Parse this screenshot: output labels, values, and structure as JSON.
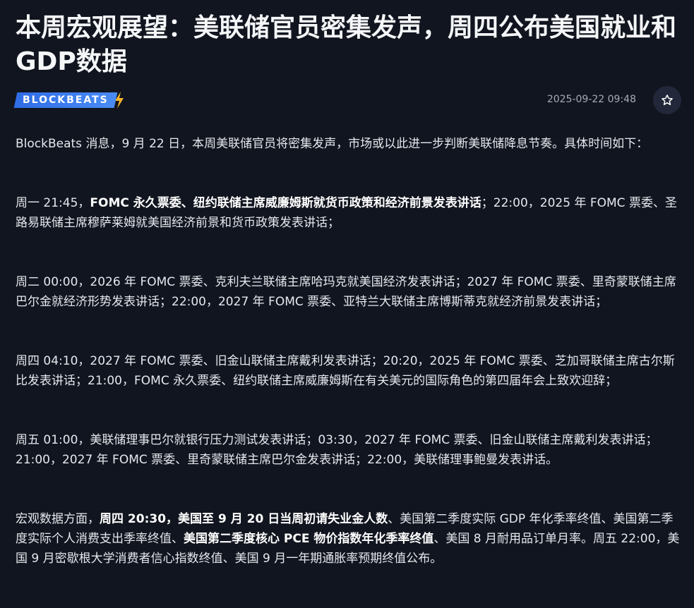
{
  "article": {
    "title": "本周宏观展望：美联储官员密集发声，周四公布美国就业和GDP数据",
    "source_logo": "BLOCKBEATS",
    "datetime": "2025-09-22 09:48",
    "favorite_icon": "star-outline-icon"
  },
  "paragraphs": [
    [
      {
        "t": "BlockBeats 消息，9 月 22 日，本周美联储官员将密集发声，市场或以此进一步判断美联储降息节奏。具体时间如下：",
        "b": false
      }
    ],
    [
      {
        "t": "周一 21:45，",
        "b": false
      },
      {
        "t": "FOMC 永久票委、纽约联储主席威廉姆斯就货币政策和经济前景发表讲话",
        "b": true
      },
      {
        "t": "；22:00，2025 年 FOMC 票委、圣路易联储主席穆萨莱姆就美国经济前景和货币政策发表讲话；",
        "b": false
      }
    ],
    [
      {
        "t": "周二 00:00，2026 年 FOMC 票委、克利夫兰联储主席哈玛克就美国经济发表讲话；2027 年 FOMC 票委、里奇蒙联储主席巴尔金就经济形势发表讲话；22:00，2027 年 FOMC 票委、亚特兰大联储主席博斯蒂克就经济前景发表讲话；",
        "b": false
      }
    ],
    [
      {
        "t": "周四 04:10，2027 年 FOMC 票委、旧金山联储主席戴利发表讲话；20:20，2025 年 FOMC 票委、芝加哥联储主席古尔斯比发表讲话；21:00，FOMC 永久票委、纽约联储主席威廉姆斯在有关美元的国际角色的第四届年会上致欢迎辞；",
        "b": false
      }
    ],
    [
      {
        "t": "周五 01:00，美联储理事巴尔就银行压力测试发表讲话；03:30，2027 年 FOMC 票委、旧金山联储主席戴利发表讲话；21:00，2027 年 FOMC 票委、里奇蒙联储主席巴尔金发表讲话；22:00，美联储理事鲍曼发表讲话。",
        "b": false
      }
    ],
    [
      {
        "t": "宏观数据方面，",
        "b": false
      },
      {
        "t": "周四 20:30，美国至 9 月 20 日当周初请失业金人数",
        "b": true
      },
      {
        "t": "、美国第二季度实际 GDP 年化季率终值、美国第二季度实际个人消费支出季率终值、",
        "b": false
      },
      {
        "t": "美国第二季度核心 PCE 物价指数年化季率终值",
        "b": true
      },
      {
        "t": "、美国 8 月耐用品订单月率。周五 22:00，美国 9 月密歇根大学消费者信心指数终值、美国 9 月一年期通胀率预期终值公布。",
        "b": false
      }
    ]
  ]
}
